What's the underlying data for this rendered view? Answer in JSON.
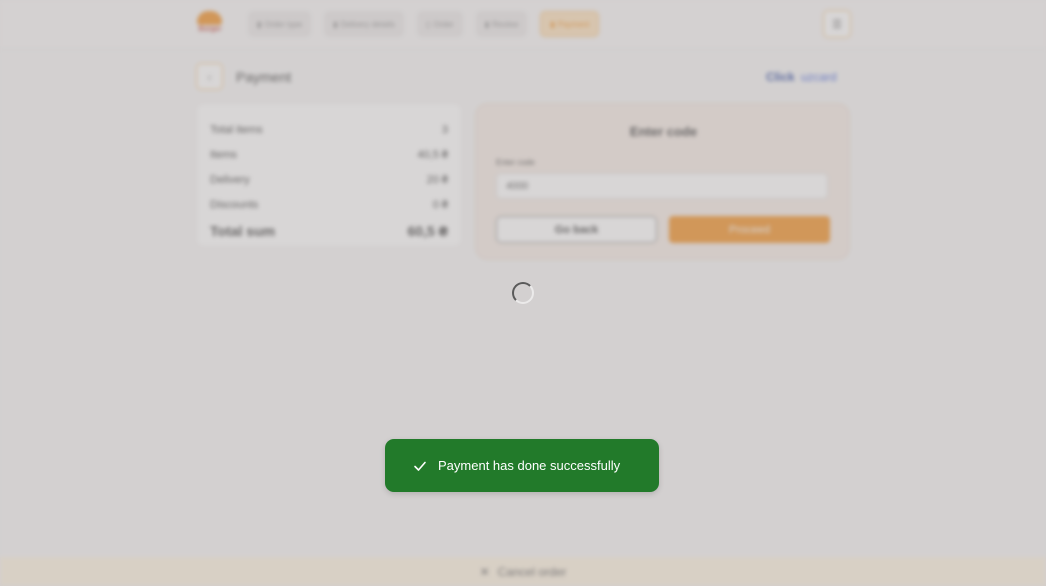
{
  "header": {
    "logo_text": "Burger",
    "steps": [
      {
        "label": "Order type"
      },
      {
        "label": "Delivery details"
      },
      {
        "label": "Order"
      },
      {
        "label": "Review"
      },
      {
        "label": "Payment"
      }
    ],
    "menu_icon": "hamburger-icon"
  },
  "page": {
    "title": "Payment",
    "brands": [
      "Click",
      "uzcard"
    ]
  },
  "summary": {
    "rows": [
      {
        "label": "Total items",
        "value": "3"
      },
      {
        "label": "Items",
        "value": "40,5 ₴"
      },
      {
        "label": "Delivery",
        "value": "20 ₴"
      },
      {
        "label": "Discounts",
        "value": "0 ₴"
      }
    ],
    "total_label": "Total sum",
    "total_value": "60,5 ₴"
  },
  "code_form": {
    "title": "Enter code",
    "field_label": "Enter code",
    "field_value": "4000",
    "back_label": "Go back",
    "proceed_label": "Proceed"
  },
  "footer": {
    "cancel_label": "Cancel order"
  },
  "toast": {
    "message": "Payment has done successfully",
    "color": "#227a2a"
  },
  "colors": {
    "accent": "#f28c1c",
    "success": "#227a2a"
  }
}
